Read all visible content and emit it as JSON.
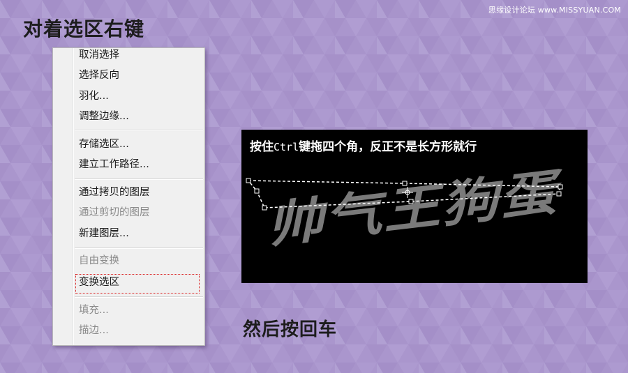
{
  "watermark": "思缘设计论坛 www.MISSYUAN.COM",
  "heading": "对着选区右键",
  "menu": {
    "items": [
      {
        "label": "取消选择",
        "enabled": true
      },
      {
        "label": "选择反向",
        "enabled": true
      },
      {
        "label": "羽化...",
        "enabled": true
      },
      {
        "label": "调整边缘...",
        "enabled": true
      },
      {
        "label": "存储选区...",
        "enabled": true
      },
      {
        "label": "建立工作路径...",
        "enabled": true
      },
      {
        "label": "通过拷贝的图层",
        "enabled": true
      },
      {
        "label": "通过剪切的图层",
        "enabled": false
      },
      {
        "label": "新建图层...",
        "enabled": true
      },
      {
        "label": "自由变换",
        "enabled": false
      },
      {
        "label": "变换选区",
        "enabled": true,
        "highlighted": true
      },
      {
        "label": "填充...",
        "enabled": false
      },
      {
        "label": "描边...",
        "enabled": false
      }
    ]
  },
  "panel": {
    "caption_before": "按住",
    "caption_key": "Ctrl",
    "caption_after": "键拖四个角，反正不是长方形就行",
    "art_text": "帅气王狗蛋"
  },
  "footer": "然后按回车",
  "colors": {
    "background": "#a995cc",
    "menu_bg": "#f0f0f0",
    "highlight_border": "#d81c1c",
    "art_text": "#7a7a7a",
    "panel_bg": "#000000"
  }
}
